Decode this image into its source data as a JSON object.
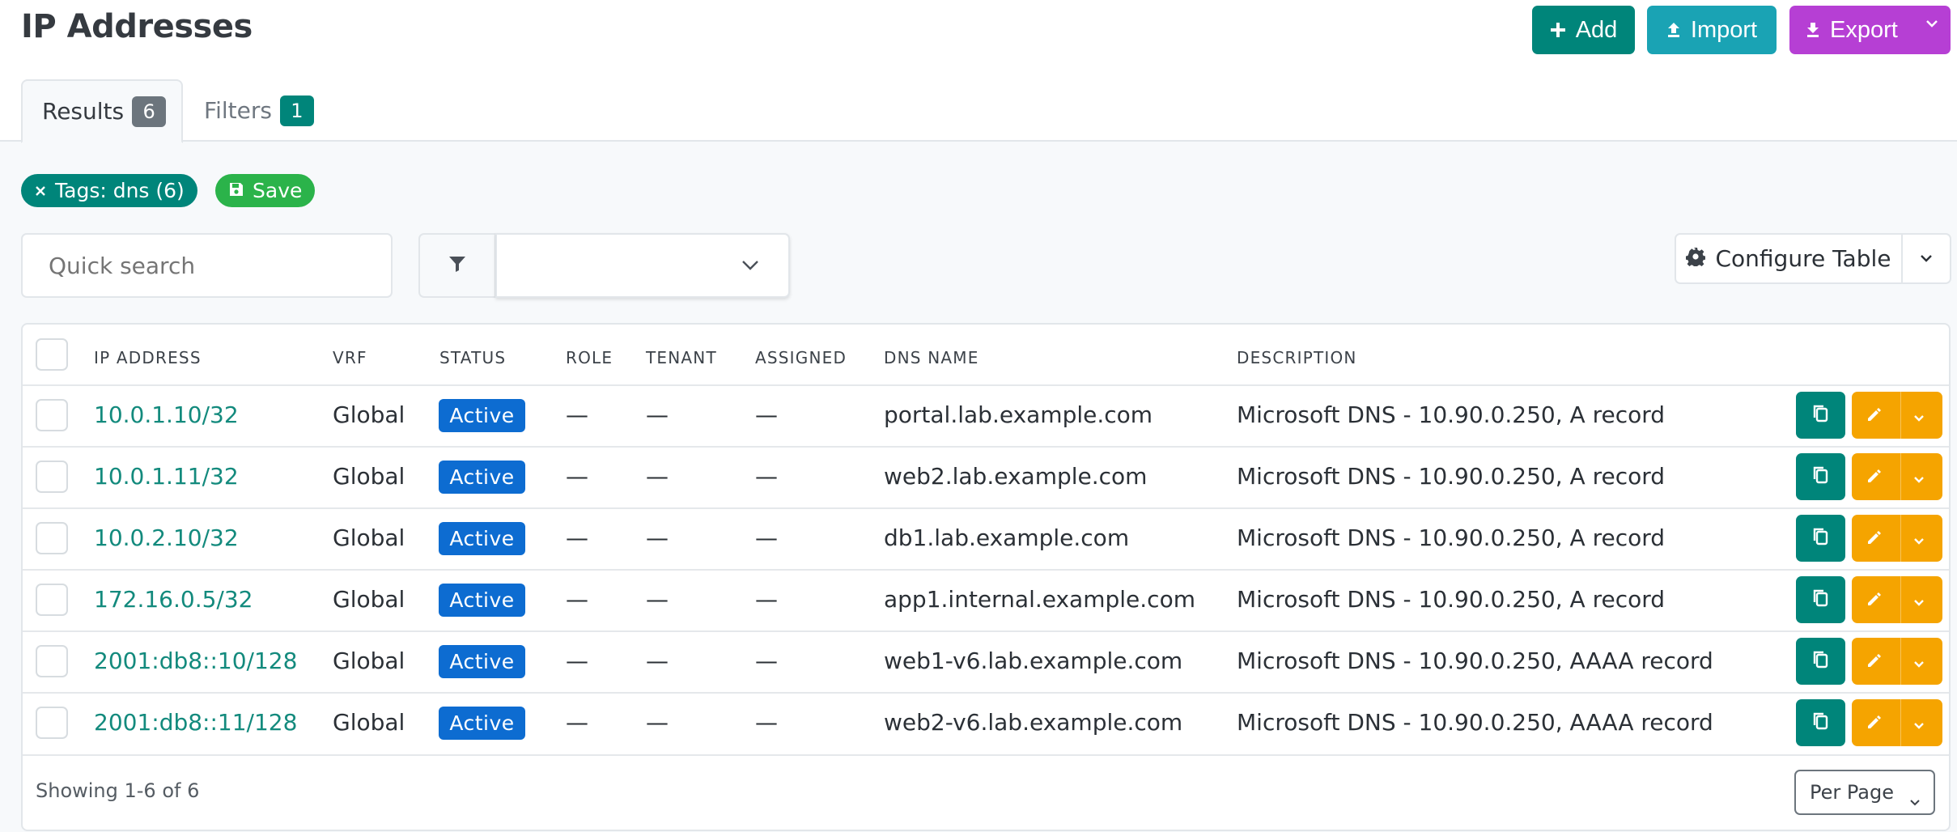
{
  "page": {
    "title": "IP Addresses"
  },
  "header_buttons": {
    "add": "Add",
    "import": "Import",
    "export": "Export"
  },
  "tabs": [
    {
      "label": "Results",
      "badge": "6"
    },
    {
      "label": "Filters",
      "badge": "1"
    }
  ],
  "filter_pills": {
    "tag": "Tags: dns (6)",
    "save": "Save"
  },
  "toolbar": {
    "search_placeholder": "Quick search",
    "configure_table": "Configure Table"
  },
  "table": {
    "columns": [
      "IP ADDRESS",
      "VRF",
      "STATUS",
      "ROLE",
      "TENANT",
      "ASSIGNED",
      "DNS NAME",
      "DESCRIPTION"
    ],
    "rows": [
      {
        "ip": "10.0.1.10/32",
        "vrf": "Global",
        "status": "Active",
        "role": "—",
        "tenant": "—",
        "assigned": "—",
        "dns": "portal.lab.example.com",
        "description": "Microsoft DNS - 10.90.0.250, A record"
      },
      {
        "ip": "10.0.1.11/32",
        "vrf": "Global",
        "status": "Active",
        "role": "—",
        "tenant": "—",
        "assigned": "—",
        "dns": "web2.lab.example.com",
        "description": "Microsoft DNS - 10.90.0.250, A record"
      },
      {
        "ip": "10.0.2.10/32",
        "vrf": "Global",
        "status": "Active",
        "role": "—",
        "tenant": "—",
        "assigned": "—",
        "dns": "db1.lab.example.com",
        "description": "Microsoft DNS - 10.90.0.250, A record"
      },
      {
        "ip": "172.16.0.5/32",
        "vrf": "Global",
        "status": "Active",
        "role": "—",
        "tenant": "—",
        "assigned": "—",
        "dns": "app1.internal.example.com",
        "description": "Microsoft DNS - 10.90.0.250, A record"
      },
      {
        "ip": "2001:db8::10/128",
        "vrf": "Global",
        "status": "Active",
        "role": "—",
        "tenant": "—",
        "assigned": "—",
        "dns": "web1-v6.lab.example.com",
        "description": "Microsoft DNS - 10.90.0.250, AAAA record"
      },
      {
        "ip": "2001:db8::11/128",
        "vrf": "Global",
        "status": "Active",
        "role": "—",
        "tenant": "—",
        "assigned": "—",
        "dns": "web2-v6.lab.example.com",
        "description": "Microsoft DNS - 10.90.0.250, AAAA record"
      }
    ]
  },
  "footer": {
    "showing": "Showing 1-6 of 6",
    "per_page": "Per Page"
  },
  "colors": {
    "primary_teal": "#00857a",
    "info_cyan": "#1aa3b4",
    "export_purple": "#b63fd4",
    "status_active": "#0d6cd1",
    "edit_orange": "#f5a400",
    "save_green": "#2bb34a"
  },
  "icons": {
    "add": "plus-icon",
    "import": "upload-icon",
    "export": "download-icon",
    "filter": "funnel-icon",
    "configure": "gear-icon",
    "copy": "copy-icon",
    "edit": "pencil-icon"
  }
}
